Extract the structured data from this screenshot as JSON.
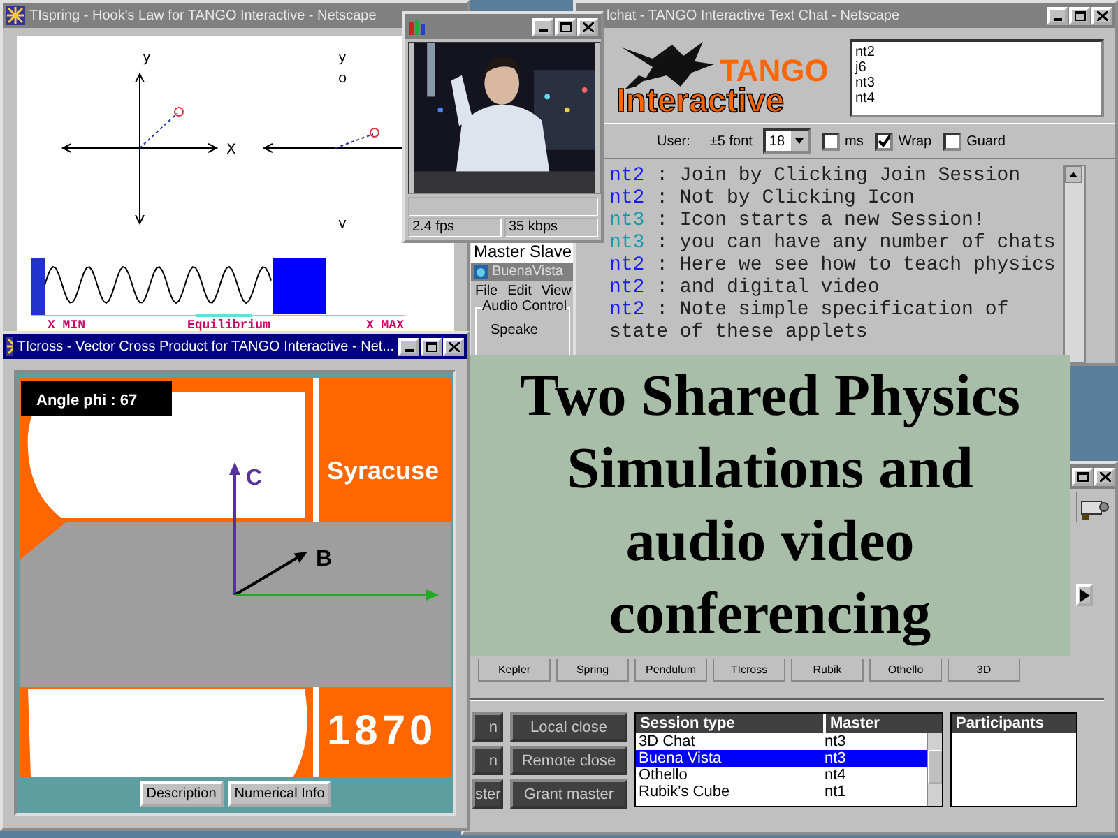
{
  "spring_window": {
    "title": "TIspring - Hook's Law for TANGO Interactive - Netscape",
    "active": false,
    "graphs": [
      {
        "y_label": "y",
        "x_label": "X"
      },
      {
        "y_label": "y",
        "marker": "o",
        "bottom_label": "v"
      }
    ],
    "spring_labels": [
      "X MIN",
      "Equilibrium",
      "X MAX"
    ]
  },
  "video_window": {
    "active": false,
    "readings": [
      "2.4 fps",
      "35 kbps"
    ]
  },
  "chat_window": {
    "title": "lchat - TANGO Interactive Text Chat - Netscape",
    "active": false,
    "logo": {
      "top": "TANGO",
      "bottom": "Interactive"
    },
    "users": [
      "nt2",
      "j6",
      "nt3",
      "nt4"
    ],
    "toolbar": {
      "user_label": "User:",
      "font_label": "±5 font",
      "font_size": "18",
      "options": [
        {
          "label": "ms",
          "checked": false
        },
        {
          "label": "Wrap",
          "checked": true
        },
        {
          "label": "Guard",
          "checked": false
        }
      ]
    },
    "messages": [
      {
        "kind": "message",
        "user": "nt2",
        "color": "#1a1aff",
        "text": " : Join by Clicking Join Session"
      },
      {
        "kind": "message",
        "user": "nt2",
        "color": "#1a1aff",
        "text": " : Not by Clicking Icon"
      },
      {
        "kind": "message",
        "user": "nt3",
        "color": "#1a9aa4",
        "text": " : Icon starts a new Session!"
      },
      {
        "kind": "message",
        "user": "nt3",
        "color": "#1a9aa4",
        "text": " : you can have any number of chats"
      },
      {
        "kind": "message",
        "user": "nt2",
        "color": "#1a1aff",
        "text": " : Here we see how to teach physics"
      },
      {
        "kind": "message",
        "user": "nt2",
        "color": "#1a1aff",
        "text": " : and digital video"
      },
      {
        "kind": "message",
        "user": "nt2",
        "color": "#1a1aff",
        "text": " : Note simple specification of"
      },
      {
        "kind": "continuation",
        "text": "state of these applets"
      }
    ]
  },
  "buena_vista": {
    "header": "Master Slave",
    "title": "BuenaVista",
    "menu": [
      "File",
      "Edit",
      "View"
    ],
    "group": "Audio Control",
    "item": "Speake"
  },
  "cross_window": {
    "title": "TIcross - Vector Cross Product for TANGO Interactive - Net...",
    "active": true,
    "angle_label": "Angle phi : 67",
    "top_text": "Syracuse",
    "bottom_text": "1870",
    "vectors": [
      {
        "label": "C",
        "color": "#553399"
      },
      {
        "label": "B",
        "color": "#000000"
      },
      {
        "color": "#22aa22"
      }
    ],
    "buttons": [
      "Description",
      "Numerical Info"
    ]
  },
  "control_window": {
    "apps": [
      "Kepler",
      "Spring",
      "Pendulum",
      "TIcross",
      "Rubik",
      "Othello",
      "3D"
    ],
    "left_buttons": [
      "n",
      "n",
      "ster"
    ],
    "right_buttons": [
      "Local close",
      "Remote close",
      "Grant master"
    ],
    "sessions": {
      "columns": [
        "Session type",
        "Master"
      ],
      "rows": [
        {
          "type": "3D Chat",
          "master": "nt3",
          "selected": false
        },
        {
          "type": "Buena Vista",
          "master": "nt3",
          "selected": true
        },
        {
          "type": "Othello",
          "master": "nt4",
          "selected": false
        },
        {
          "type": "Rubik's Cube",
          "master": "nt1",
          "selected": false
        }
      ]
    },
    "participants": {
      "title": "Participants"
    }
  },
  "caption": {
    "text": "Two Shared Physics Simulations and audio video conferencing"
  }
}
